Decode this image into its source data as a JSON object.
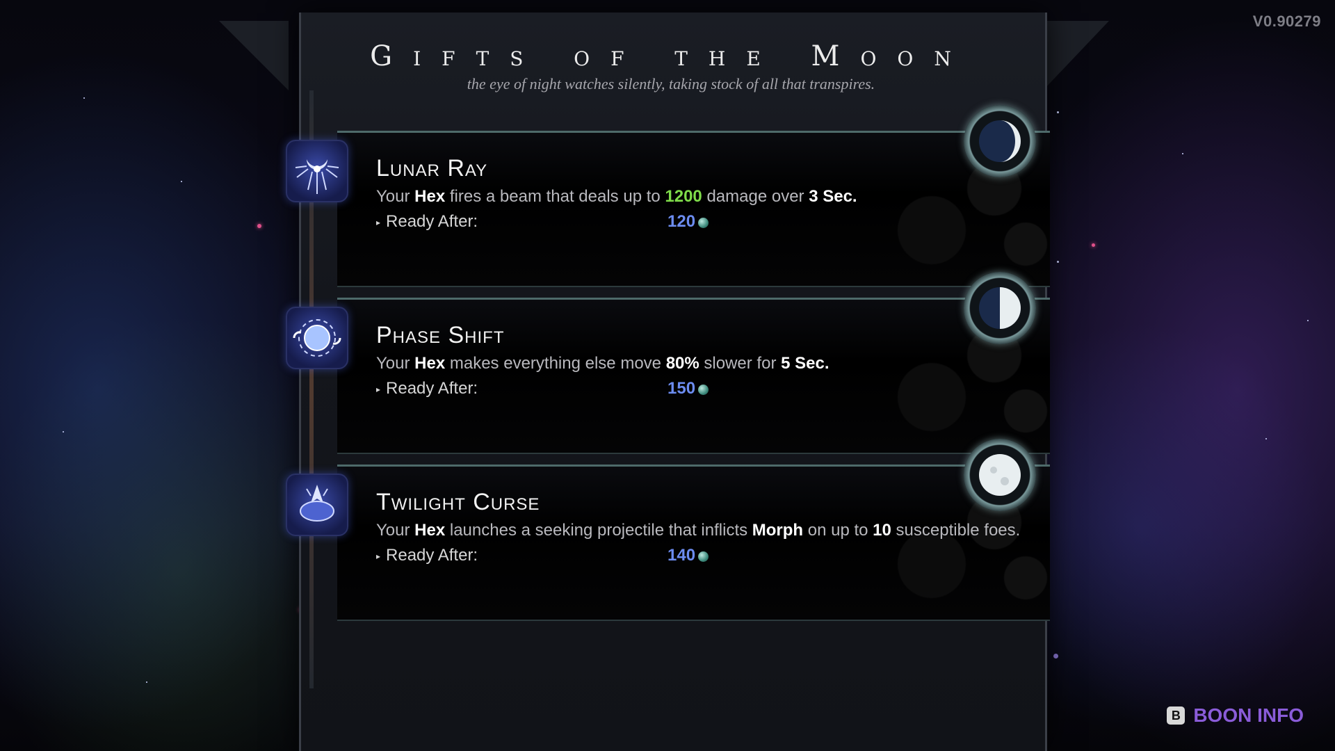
{
  "version": "V0.90279",
  "header": {
    "title": "Gifts of the Moon",
    "subtitle": "the eye of night watches silently, taking stock of all that transpires."
  },
  "boons": [
    {
      "name": "Lunar Ray",
      "desc_pre": "Your ",
      "desc_hex": "Hex",
      "desc_mid": " fires a beam that deals up to ",
      "desc_val1": "1200",
      "desc_mid2": " damage over ",
      "desc_val2": "3 Sec.",
      "ready_label": "Ready After:",
      "cost": "120",
      "moon_phase": "crescent",
      "icon": "lunar-ray-icon"
    },
    {
      "name": "Phase Shift",
      "desc_pre": "Your ",
      "desc_hex": "Hex",
      "desc_mid": " makes everything else move ",
      "desc_val1": "80%",
      "desc_mid2": " slower for ",
      "desc_val2": "5 Sec.",
      "ready_label": "Ready After:",
      "cost": "150",
      "moon_phase": "half",
      "icon": "phase-shift-icon"
    },
    {
      "name": "Twilight Curse",
      "desc_pre": "Your ",
      "desc_hex": "Hex",
      "desc_mid": " launches a seeking projectile that inflicts ",
      "desc_val1": "Morph",
      "desc_mid2": " on up to ",
      "desc_val2": "10",
      "desc_post": " susceptible foes.",
      "ready_label": "Ready After:",
      "cost": "140",
      "moon_phase": "full",
      "icon": "twilight-curse-icon"
    }
  ],
  "footer": {
    "key": "B",
    "label": "BOON INFO"
  },
  "colors": {
    "accent_green": "#7fdc4a",
    "cost_blue": "#6c8cf0",
    "boon_info_purple": "#8a5cd8"
  }
}
